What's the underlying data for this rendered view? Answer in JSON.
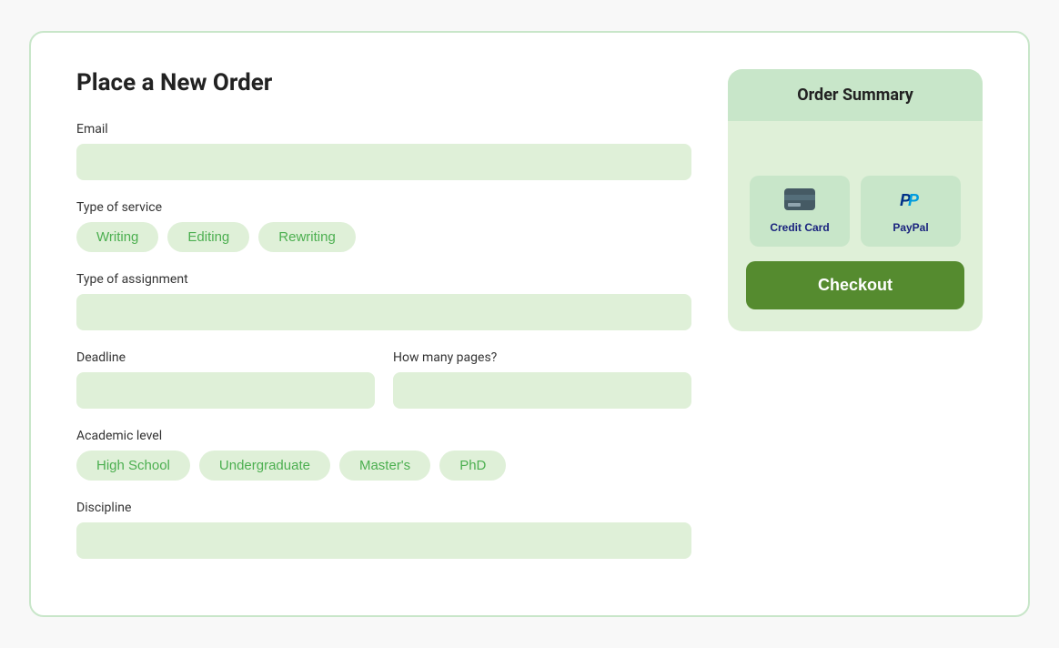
{
  "page": {
    "title": "Place a New Order"
  },
  "form": {
    "email_label": "Email",
    "email_placeholder": "",
    "service_label": "Type of service",
    "service_options": [
      "Writing",
      "Editing",
      "Rewriting"
    ],
    "assignment_label": "Type of assignment",
    "assignment_placeholder": "",
    "deadline_label": "Deadline",
    "deadline_placeholder": "",
    "pages_label": "How many pages?",
    "pages_placeholder": "",
    "academic_label": "Academic level",
    "academic_options": [
      "High School",
      "Undergraduate",
      "Master's",
      "PhD"
    ],
    "discipline_label": "Discipline",
    "discipline_placeholder": ""
  },
  "order_summary": {
    "title": "Order Summary",
    "credit_card_label": "Credit Card",
    "paypal_label": "PayPal",
    "checkout_label": "Checkout"
  }
}
